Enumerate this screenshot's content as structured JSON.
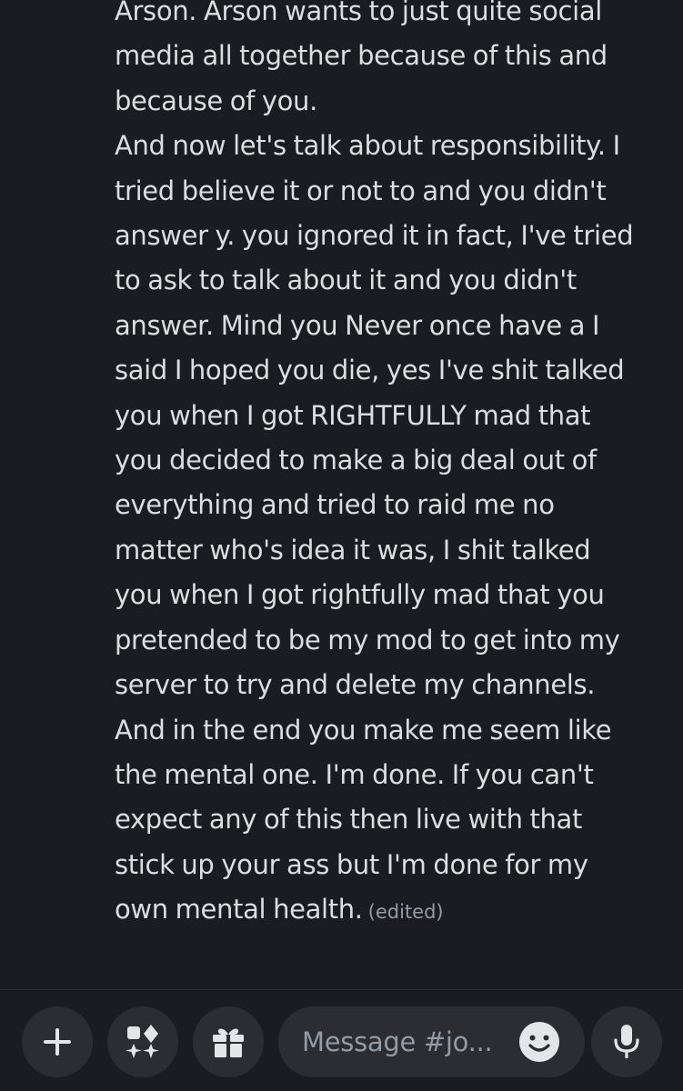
{
  "message": {
    "lines": [
      "Arson. Arson wants to just quite social",
      "media all together because of this and",
      "because of you.",
      "And now let's talk about responsibility. I",
      "tried believe it or not to and you didn't",
      "answer y. you ignored it in fact, I've tried",
      "to ask to talk about it and you didn't",
      "answer. Mind you Never once have a I",
      "said I hoped you die, yes I've shit talked",
      "you when I got RIGHTFULLY mad that",
      "you decided to make a big deal out of",
      "everything and tried to raid me no",
      "matter who's idea it was, I shit talked",
      "you when I got rightfully mad that you",
      "pretended to be my mod to get into my",
      "server to try and delete my channels.",
      "And in the end you make me seem like",
      "the mental one. I'm done. If you can't",
      "expect any of this then live with that",
      "stick up your ass but I'm done for my",
      "own mental health."
    ],
    "edited_label": "(edited)"
  },
  "composer": {
    "placeholder": "Message #jo...",
    "buttons": {
      "add": "plus-icon",
      "apps": "apps-icon",
      "gift": "gift-icon",
      "emoji": "emoji-icon",
      "voice": "microphone-icon"
    }
  },
  "colors": {
    "background": "#1b1c21",
    "text": "#dbdee1",
    "muted_text": "#949ba4",
    "button_background": "#2b2d33",
    "icon": "#e3e5e8"
  }
}
